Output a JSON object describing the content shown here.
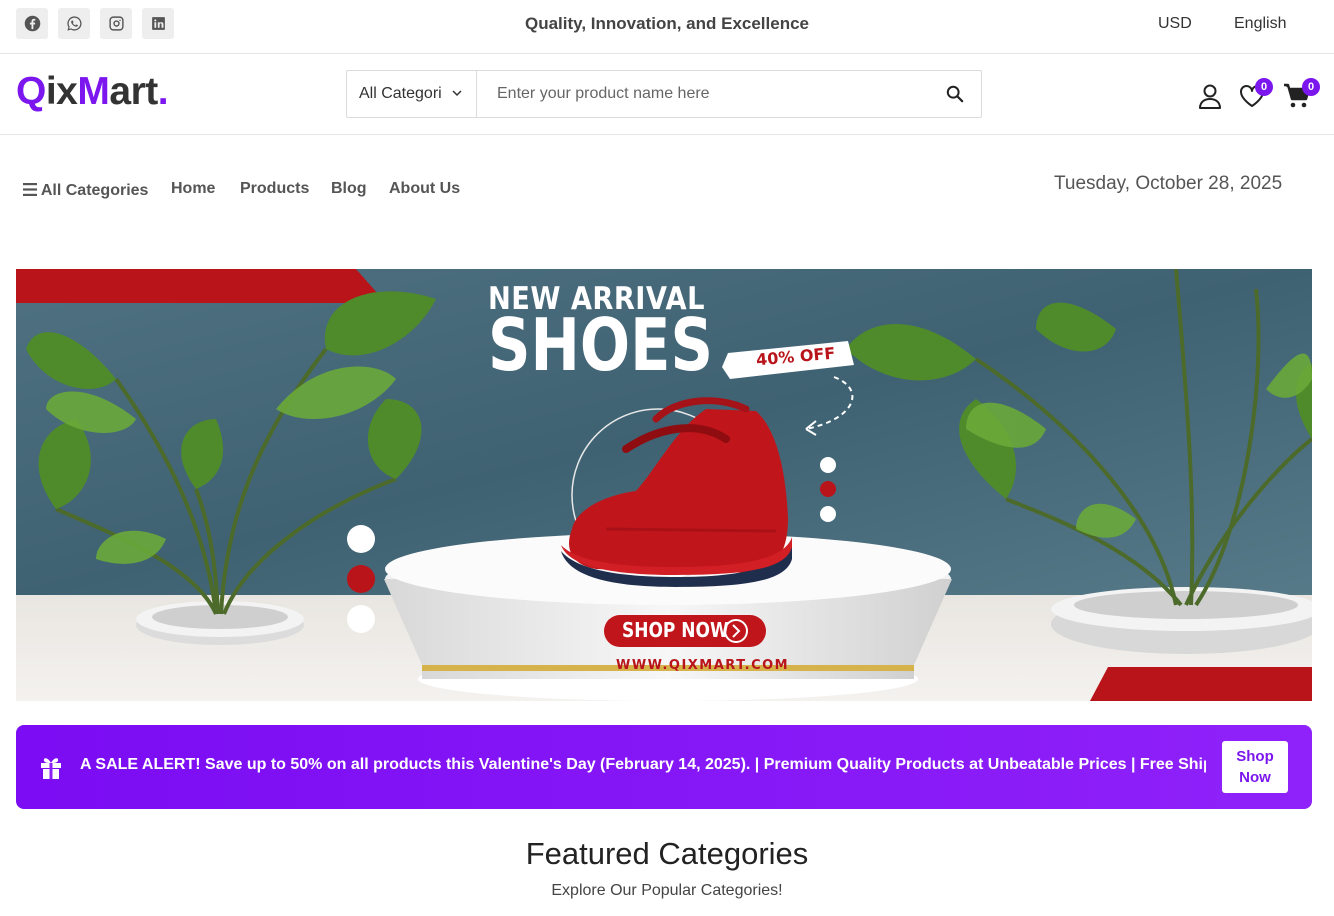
{
  "topbar": {
    "social": [
      {
        "icon": "facebook-icon"
      },
      {
        "icon": "whatsapp-icon"
      },
      {
        "icon": "instagram-icon"
      },
      {
        "icon": "linkedin-icon"
      }
    ],
    "tagline": "Quality, Innovation, and Excellence",
    "currency": "USD",
    "language": "English"
  },
  "header": {
    "logo_part1": "Q",
    "logo_part2": "ix",
    "logo_part3": "M",
    "logo_part4": "art",
    "logo_dot": ".",
    "search": {
      "category": "All Categories",
      "placeholder": "Enter your product name here"
    },
    "wishlist_count": "0",
    "cart_count": "0"
  },
  "nav": {
    "all_categories": "All Categories",
    "items": [
      "Home",
      "Products",
      "Blog",
      "About Us"
    ],
    "date": "Tuesday, October 28, 2025"
  },
  "banner": {
    "line1": "NEW ARRIVAL",
    "line2": "SHOES",
    "discount": "40% OFF",
    "cta": "SHOP NOW",
    "url": "WWW.QIXMART.COM"
  },
  "promo": {
    "text": "A SALE ALERT! Save up to 50% on all products this Valentine's Day (February 14, 2025). | Premium Quality Products at Unbeatable Prices | Free Shipping on Orders",
    "button_line1": "Shop",
    "button_line2": "Now"
  },
  "featured": {
    "title": "Featured Categories",
    "subtitle": "Explore Our Popular Categories!"
  },
  "colors": {
    "brand": "#7b16ee",
    "banner_red": "#b8141a"
  }
}
